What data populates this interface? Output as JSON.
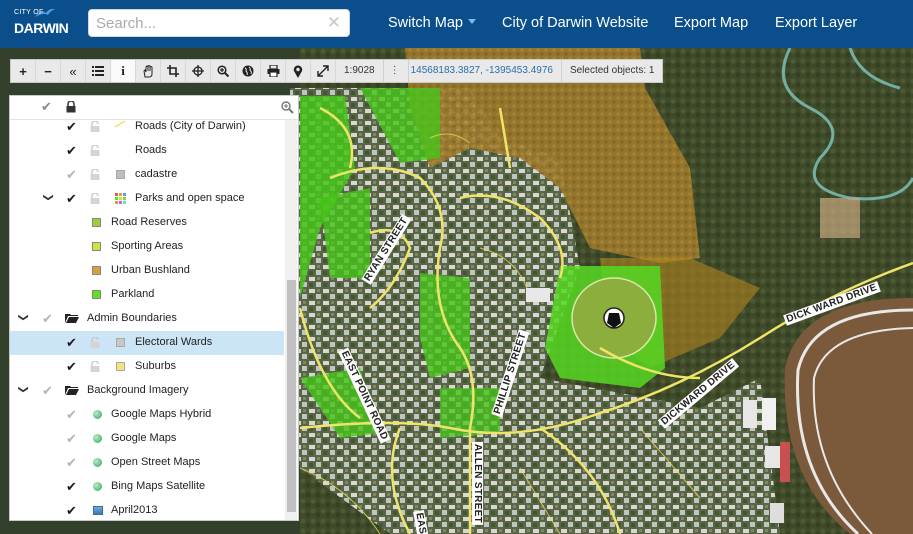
{
  "navbar": {
    "logo_city": "CITY OF",
    "logo_darwin": "DARWIN",
    "search_placeholder": "Search...",
    "switch_map": "Switch Map",
    "website": "City of Darwin Website",
    "export_map": "Export Map",
    "export_layer": "Export Layer"
  },
  "toolbar": {
    "scale": "1:9028",
    "coordinates": "14568183.3827, -1395453.4976",
    "selected": "Selected objects: 1",
    "tools": [
      "zoom-in",
      "zoom-out",
      "collapse",
      "layers-list",
      "info",
      "pan",
      "crop",
      "center",
      "zoom-box",
      "globe",
      "print",
      "marker",
      "fullscreen"
    ]
  },
  "layers": [
    {
      "label": "Roads (City of Darwin)",
      "checked": true,
      "locked": false,
      "swatch": "line",
      "swatch_color": "#f0e060"
    },
    {
      "label": "Roads",
      "checked": true,
      "locked": false,
      "swatch": "none"
    },
    {
      "label": "cadastre",
      "checked": false,
      "locked": false,
      "swatch": "fill",
      "swatch_color": "#bdbdbd"
    },
    {
      "label": "Parks and open space",
      "checked": true,
      "locked": false,
      "swatch": "grid",
      "expanded": true
    },
    {
      "label": "Road Reserves",
      "swatch_color": "#9dcc3c",
      "legend": true
    },
    {
      "label": "Sporting Areas",
      "swatch_color": "#c6e83c",
      "legend": true
    },
    {
      "label": "Urban Bushland",
      "swatch_color": "#d9a03a",
      "legend": true
    },
    {
      "label": "Parkland",
      "swatch_color": "#5ee21e",
      "legend": true
    },
    {
      "label": "Admin Boundaries",
      "group": true,
      "expanded": true
    },
    {
      "label": "Electoral Wards",
      "checked": true,
      "locked": false,
      "swatch_color": "#c8c8c8",
      "selected": true
    },
    {
      "label": "Suburbs",
      "checked": true,
      "locked": false,
      "swatch_color": "#f5e27a"
    },
    {
      "label": "Background Imagery",
      "group": true,
      "expanded": true
    },
    {
      "label": "Google Maps Hybrid",
      "checked": false,
      "icon": "globe"
    },
    {
      "label": "Google Maps",
      "checked": false,
      "icon": "globe"
    },
    {
      "label": "Open Street Maps",
      "checked": false,
      "icon": "globe"
    },
    {
      "label": "Bing Maps Satellite",
      "checked": true,
      "icon": "globe"
    },
    {
      "label": "April2013",
      "checked": true,
      "icon": "image"
    }
  ],
  "map_labels": {
    "ryan_street": "RYAN STREET",
    "phillip_street": "PHILLIP STREET",
    "dickward_drive_1": "DICKWARD DRIVE",
    "dickward_drive_2": "DICK WARD DRIVE",
    "east_point_road": "EAST POINT ROAD",
    "allen_street": "ALLEN STREET",
    "east_point_road_2": "EAS"
  },
  "colors": {
    "navbar": "#0a4f8c",
    "parkland": "#5ee21e",
    "urban_bushland": "#d9a03a",
    "road": "#f0e36a",
    "selection": "#cce5f6"
  }
}
